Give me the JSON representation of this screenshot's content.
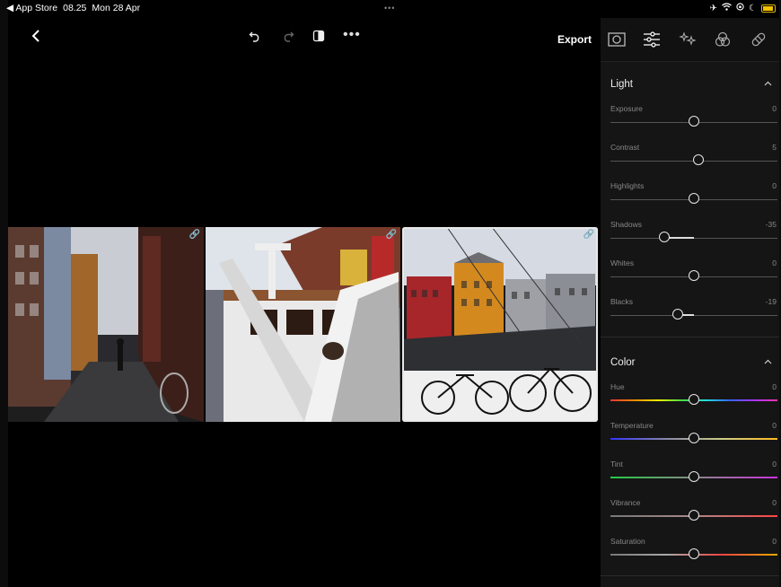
{
  "status": {
    "back_app": "◀ App Store",
    "time": "08.25",
    "date": "Mon 28 Apr",
    "dots": "•••"
  },
  "toolbar": {
    "export_label": "Export"
  },
  "photos": [
    {
      "name": "copenhagen-street",
      "linked": true,
      "selected": false
    },
    {
      "name": "snowy-boat",
      "linked": true,
      "selected": false
    },
    {
      "name": "nyhavn-harbor",
      "linked": true,
      "selected": true
    }
  ],
  "panel": {
    "tabs": [
      "preset-icon",
      "adjust-icon",
      "effects-icon",
      "color-mix-icon",
      "heal-icon"
    ],
    "active_tab": 1,
    "light": {
      "title": "Light",
      "sliders": [
        {
          "label": "Exposure",
          "value": "0",
          "pos": 0.5
        },
        {
          "label": "Contrast",
          "value": "5",
          "pos": 0.525
        },
        {
          "label": "Highlights",
          "value": "0",
          "pos": 0.5
        },
        {
          "label": "Shadows",
          "value": "-35",
          "pos": 0.325
        },
        {
          "label": "Whites",
          "value": "0",
          "pos": 0.5
        },
        {
          "label": "Blacks",
          "value": "-19",
          "pos": 0.405
        }
      ]
    },
    "color": {
      "title": "Color",
      "sliders": [
        {
          "label": "Hue",
          "value": "0",
          "pos": 0.5,
          "gradient": "linear-gradient(90deg,#e33,#e80,#ee0,#4d4,#2dd,#36f,#a3f,#e3a)"
        },
        {
          "label": "Temperature",
          "value": "0",
          "pos": 0.5,
          "gradient": "linear-gradient(90deg,#33f,#88a,#cc8,#fb2)"
        },
        {
          "label": "Tint",
          "value": "0",
          "pos": 0.5,
          "gradient": "linear-gradient(90deg,#2c4,#888,#c3d)"
        },
        {
          "label": "Vibrance",
          "value": "0",
          "pos": 0.5,
          "gradient": "linear-gradient(90deg,#777,#a88,#f44)"
        },
        {
          "label": "Saturation",
          "value": "0",
          "pos": 0.5,
          "gradient": "linear-gradient(90deg,#777,#aaa,#e44,#ea0)"
        }
      ]
    }
  },
  "colors": {
    "background": "#000000",
    "panel": "#151515",
    "battery": "#f2c200"
  }
}
